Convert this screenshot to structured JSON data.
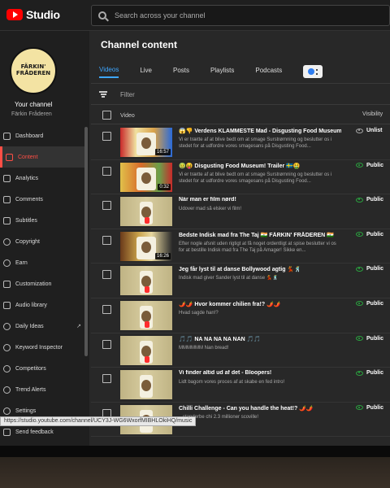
{
  "app": {
    "logo_text": "Studio"
  },
  "search": {
    "placeholder": "Search across your channel"
  },
  "sidebar": {
    "avatar_text": "FÄRKIN' FRÅDEREN",
    "your_channel": "Your channel",
    "channel_name": "Färkin Fråderen",
    "items": [
      {
        "label": "Dashboard",
        "icon": "dashboard-icon"
      },
      {
        "label": "Content",
        "icon": "content-icon",
        "active": true
      },
      {
        "label": "Analytics",
        "icon": "analytics-icon"
      },
      {
        "label": "Comments",
        "icon": "comments-icon"
      },
      {
        "label": "Subtitles",
        "icon": "subtitles-icon"
      },
      {
        "label": "Copyright",
        "icon": "copyright-icon"
      },
      {
        "label": "Earn",
        "icon": "earn-icon"
      },
      {
        "label": "Customization",
        "icon": "customization-icon"
      },
      {
        "label": "Audio library",
        "icon": "audio-library-icon"
      },
      {
        "label": "Daily Ideas",
        "icon": "daily-ideas-icon",
        "external": true
      },
      {
        "label": "Keyword Inspector",
        "icon": "keyword-inspector-icon"
      },
      {
        "label": "Competitors",
        "icon": "competitors-icon"
      },
      {
        "label": "Trend Alerts",
        "icon": "trend-alerts-icon"
      },
      {
        "label": "Settings",
        "icon": "settings-icon"
      },
      {
        "label": "Send feedback",
        "icon": "send-feedback-icon"
      }
    ]
  },
  "main": {
    "title": "Channel content",
    "tabs": [
      {
        "label": "Videos",
        "active": true
      },
      {
        "label": "Live"
      },
      {
        "label": "Posts"
      },
      {
        "label": "Playlists"
      },
      {
        "label": "Podcasts"
      }
    ],
    "filter_label": "Filter",
    "columns": {
      "video": "Video",
      "visibility": "Visibility"
    },
    "rows": [
      {
        "title": "😱👎 Verdens KLAMMESTE Mad - Disgusting Food Museum! 🇸🇪",
        "description": "Vi er trætte af at blive bedt om at smage Surstrømning og beslutter os i stedet for at udfordre vores smagesans på Disgusting Food...",
        "duration": "16:57",
        "visibility": "Unlisted",
        "visibility_shown": "Unlist"
      },
      {
        "title": "🤢😝 Disgusting Food Museum! Trailer 🇸🇪🤮",
        "description": "Vi er trætte af at blive bedt om at smage Surstrømning og beslutter os i stedet for at udfordre vores smagesans på Disgusting Food...",
        "duration": "0:32",
        "visibility": "Public"
      },
      {
        "title": "Når man er film nørd!",
        "description": "Udover mad så elsker vi film!",
        "visibility": "Public"
      },
      {
        "title": "Bedste Indisk mad fra The Taj 🇮🇳 FÄRKIN' FRÅDEREN 🇮🇳",
        "description": "Efter nogle afsnit uden rigtigt at få noget ordentligt at spise beslutter vi os for at bestille Indisk mad fra The Taj på Amager! Sikke en...",
        "duration": "16:26",
        "visibility": "Public"
      },
      {
        "title": "Jeg får lyst til at danse Bollywood agtig 💃🕺",
        "description": "Indisk mad giver Sander lyst til at danse 💃🕺",
        "visibility": "Public"
      },
      {
        "title": "🌶️🌶️ Hvor kommer chilien fra!? 🌶️🌶️",
        "description": "Hvad sagde han!?",
        "visibility": "Public"
      },
      {
        "title": "🎵🎵 NA NA NA NA NAN 🎵🎵",
        "description": "MMMMMM Nan bread!",
        "visibility": "Public"
      },
      {
        "title": "Vi finder altid ud af det - Bloopers!",
        "description": "Lidt bagom vores proces af at skabe en fed intro!",
        "visibility": "Public"
      },
      {
        "title": "Chilli Challenge - Can you handle the heat!? 🌶️🌶️",
        "description": "...standerbe chi 2.3 millioner scoville!",
        "visibility": "Public"
      }
    ]
  },
  "status_url": "https://studio.youtube.com/channel/UCY3J-WG6WxorfMIBHLOkiHQ/music",
  "colors": {
    "accent_red": "#ff0000",
    "tab_blue": "#3ea6ff",
    "public_green": "#2ba640"
  }
}
